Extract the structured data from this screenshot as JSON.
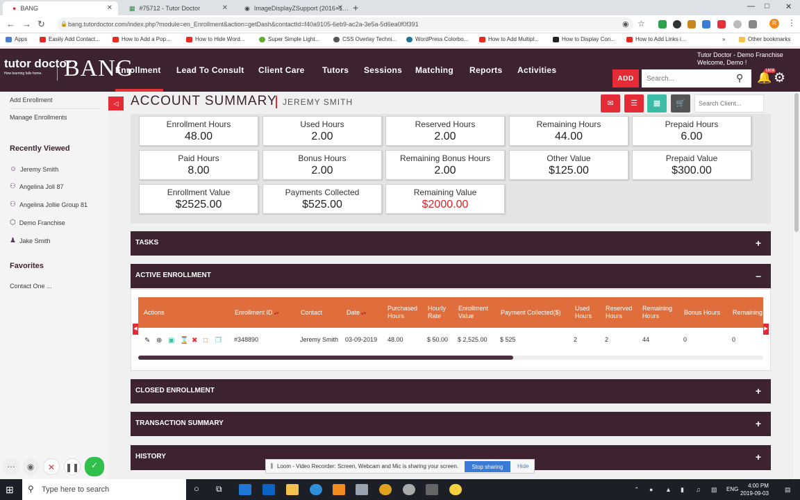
{
  "browser": {
    "tabs": [
      {
        "title": "BANG"
      },
      {
        "title": "#75712 - Tutor Doctor"
      },
      {
        "title": "ImageDisplayZSupport (2016×1…"
      }
    ],
    "url": "bang.tutordoctor.com/index.php?module=en_Enrollment&action=getDash&contactId=f40a9105-6eb9-ac2a-3e5a-5d6ea0f0f391",
    "bookmarks": [
      {
        "label": "Apps"
      },
      {
        "label": "Easily Add Contact..."
      },
      {
        "label": "How to Add a Pop..."
      },
      {
        "label": "How to Hide Word..."
      },
      {
        "label": "Super Simple Light..."
      },
      {
        "label": "CSS Overlay Techni..."
      },
      {
        "label": "WordPress Colorbo..."
      },
      {
        "label": "How to Add Multipl..."
      },
      {
        "label": "How to Display Con..."
      },
      {
        "label": "How to Add Links i..."
      },
      {
        "label": "Other bookmarks"
      }
    ],
    "profile_letter": "R"
  },
  "header": {
    "logo_text": "tutor doctor",
    "logo_sub": "How learning falls home.",
    "app_name": "BANG",
    "nav": [
      "Enrollment",
      "Lead To Consult",
      "Client Care",
      "Tutors",
      "Sessions",
      "Matching",
      "Reports",
      "Activities"
    ],
    "add_label": "ADD",
    "search_placeholder": "Search...",
    "user_line1": "Tutor Doctor - Demo Franchise",
    "user_line2": "Welcome, Demo !",
    "notification_count": "1808"
  },
  "sidebar": {
    "links": [
      {
        "label": "Add Enrollment"
      },
      {
        "label": "Manage Enrollments"
      }
    ],
    "recently_viewed_title": "Recently Viewed",
    "recently_viewed": [
      {
        "label": "Jeremy Smith",
        "icon": "user-icon"
      },
      {
        "label": "Angelina Joli 87",
        "icon": "users-icon"
      },
      {
        "label": "Angelina Jollie Group 81",
        "icon": "users-icon"
      },
      {
        "label": "Demo Franchise",
        "icon": "cube-icon"
      },
      {
        "label": "Jake Smith",
        "icon": "user-solid-icon"
      }
    ],
    "favorites_title": "Favorites",
    "favorites": [
      {
        "label": "Contact One ..."
      }
    ]
  },
  "account": {
    "title": "ACCOUNT SUMMARY",
    "name": "JEREMY SMITH",
    "search_placeholder": "Search Client...",
    "cards": [
      {
        "label": "Enrollment Hours",
        "value": "48.00"
      },
      {
        "label": "Used Hours",
        "value": "2.00"
      },
      {
        "label": "Reserved Hours",
        "value": "2.00"
      },
      {
        "label": "Remaining Hours",
        "value": "44.00"
      },
      {
        "label": "Prepaid Hours",
        "value": "6.00"
      },
      {
        "label": "Paid Hours",
        "value": "8.00"
      },
      {
        "label": "Bonus Hours",
        "value": "2.00"
      },
      {
        "label": "Remaining Bonus Hours",
        "value": "2.00"
      },
      {
        "label": "Other Value",
        "value": "$125.00"
      },
      {
        "label": "Prepaid Value",
        "value": "$300.00"
      },
      {
        "label": "Enrollment Value",
        "value": "$2525.00"
      },
      {
        "label": "Payments Collected",
        "value": "$525.00"
      },
      {
        "label": "Remaining Value",
        "value": "$2000.00"
      }
    ],
    "remaining_value_color": "#d8232a"
  },
  "panels": {
    "tasks": "TASKS",
    "active": "ACTIVE ENROLLMENT",
    "closed": "CLOSED ENROLLMENT",
    "transactions": "TRANSACTION SUMMARY",
    "history": "HISTORY",
    "expand_symbol": "+",
    "collapse_symbol": "–"
  },
  "enrollment_table": {
    "headers": {
      "actions": "Actions",
      "id": "Enrollment ID",
      "contact": "Contact",
      "date": "Date",
      "purchased": "Purchased Hours",
      "rate": "Hourly Rate",
      "value": "Enrollment Value",
      "paid": "Payment Collected($)",
      "used": "Used Hours",
      "reserved": "Reserved Hours",
      "remaining": "Remaining Hours",
      "bonus": "Bonus Hours",
      "remaining2": "Remaining"
    },
    "row": {
      "id": "#348890",
      "contact": "Jeremy Smith",
      "date": "03-09-2019",
      "purchased": "48.00",
      "rate": "$ 50.00",
      "value": "$ 2,525.00",
      "paid": "$ 525",
      "used": "2",
      "reserved": "2",
      "remaining": "44",
      "bonus": "0",
      "remaining2": "0"
    },
    "header_color": "#e06e3c"
  },
  "loom": {
    "text": "Loom - Video Recorder: Screen, Webcam and Mic is sharing your screen.",
    "stop": "Stop sharing",
    "hide": "Hide"
  },
  "taskbar": {
    "search_placeholder": "Type here to search",
    "lang": "ENG",
    "time": "4:00 PM",
    "date": "2019-09-03"
  },
  "colors": {
    "brand": "#3d2330",
    "accent": "#e52b36"
  }
}
